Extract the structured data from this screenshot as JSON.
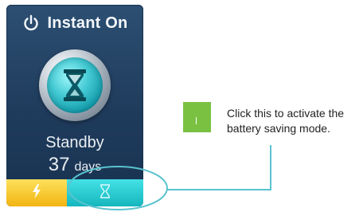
{
  "widget": {
    "title": "Instant On",
    "status": "Standby",
    "days_value": "37",
    "days_unit": "days",
    "icons": {
      "title": "power-icon",
      "center": "hourglass-icon",
      "bar_left": "lightning-icon",
      "bar_right": "hourglass-icon"
    },
    "colors": {
      "panel": "#23476a",
      "bar_left": "#f7c21e",
      "bar_right": "#1cc0c6",
      "highlight": "#59c3cf",
      "tip": "#7ac142"
    }
  },
  "callout": {
    "lines": [
      "Click this to activate the",
      "battery saving mode."
    ]
  }
}
